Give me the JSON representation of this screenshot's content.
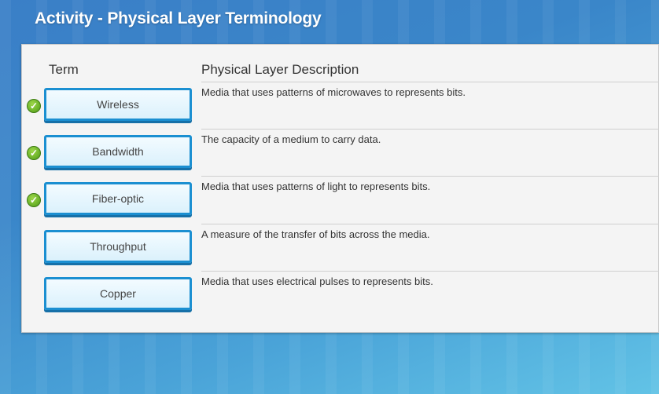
{
  "activity": {
    "title": "Activity - Physical Layer Terminology"
  },
  "table": {
    "headers": {
      "term": "Term",
      "description": "Physical Layer Description"
    },
    "rows": [
      {
        "term": "Wireless",
        "description": "Media that uses patterns of microwaves to represents bits.",
        "correct": true
      },
      {
        "term": "Bandwidth",
        "description": "The capacity of a medium to carry data.",
        "correct": true
      },
      {
        "term": "Fiber-optic",
        "description": "Media that uses patterns of light to represents bits.",
        "correct": true
      },
      {
        "term": "Throughput",
        "description": "A measure of the transfer of bits across the media.",
        "correct": false
      },
      {
        "term": "Copper",
        "description": "Media that uses electrical pulses to represents bits.",
        "correct": false
      }
    ]
  },
  "icons": {
    "check": "check-circle-icon"
  },
  "colors": {
    "accent": "#1b8fd1",
    "check_green": "#6db42a"
  }
}
